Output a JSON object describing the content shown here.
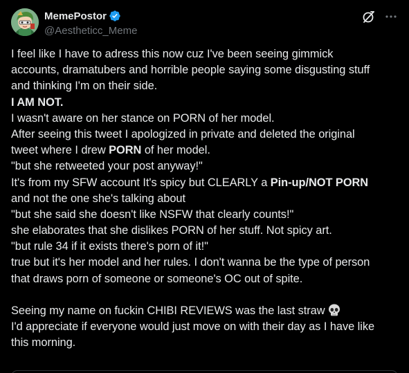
{
  "author": {
    "display_name": "MemePostor",
    "handle": "@Aestheticc_Meme",
    "verified": true,
    "avatar_icon": "avatar-chibi-character"
  },
  "icons": {
    "grok": "grok-icon",
    "more": "more-icon",
    "verified": "verified-badge-icon",
    "skull": "skull-emoji-icon"
  },
  "colors": {
    "background": "#000000",
    "text": "#e7e9ea",
    "secondary_text": "#71767b",
    "verified_blue": "#1d9bf0"
  },
  "post": {
    "l1": "I feel like I have to adress this now cuz I've been seeing gimmick",
    "l2": "accounts, dramatubers and horrible people saying some disgusting stuff",
    "l3": "and thinking I'm on their side.",
    "l4": "I AM NOT.",
    "l5": "I wasn't aware on her stance on PORN of her model.",
    "l6": "After seeing this tweet I apologized in private and deleted the original",
    "l7_a": "tweet where I drew ",
    "l7_b": "PORN",
    "l7_c": " of her model.",
    "l8": "\"but she retweeted your post anyway!\"",
    "l9_a": "It's from my SFW account It's spicy but CLEARLY a ",
    "l9_b": "Pin-up/NOT PORN",
    "l10": "and not the one she's talking about",
    "l11": "\"but she said she doesn't like NSFW that clearly counts!\"",
    "l12": "she elaborates that she dislikes PORN of her stuff. Not spicy art.",
    "l13": "\"but rule 34 if it exists there's porn of it!\"",
    "l14": "true but it's her model and her rules. I don't wanna be the type of person",
    "l15": "that draws porn of someone or someone's OC out of spite.",
    "l16": "Seeing my name on fuckin CHIBI REVIEWS was the last straw",
    "l17": "I'd appreciate if everyone would just move on with their day as I have like",
    "l18": "this morning."
  }
}
